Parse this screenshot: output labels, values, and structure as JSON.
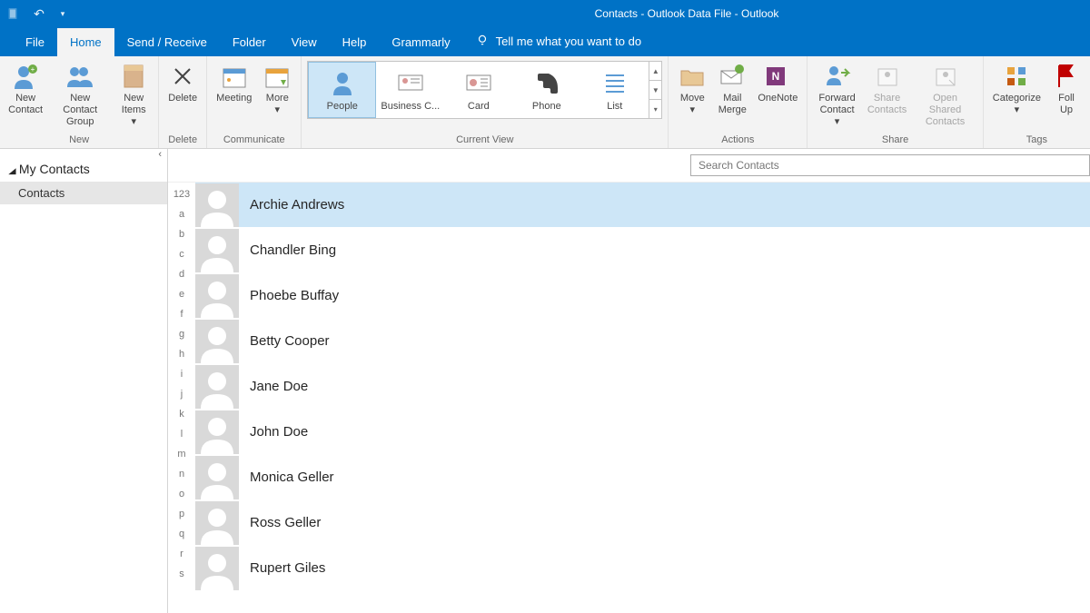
{
  "window": {
    "title": "Contacts - Outlook Data File  -  Outlook"
  },
  "tabs": {
    "file": "File",
    "home": "Home",
    "sendreceive": "Send / Receive",
    "folder": "Folder",
    "view": "View",
    "help": "Help",
    "grammarly": "Grammarly",
    "tellme": "Tell me what you want to do"
  },
  "ribbon": {
    "new": {
      "label": "New",
      "newcontact": "New\nContact",
      "newgroup": "New Contact\nGroup",
      "newitems": "New\nItems ▾"
    },
    "delete": {
      "label": "Delete",
      "delete": "Delete"
    },
    "communicate": {
      "label": "Communicate",
      "meeting": "Meeting",
      "more": "More\n▾"
    },
    "currentview": {
      "label": "Current View",
      "people": "People",
      "business": "Business C...",
      "card": "Card",
      "phone": "Phone",
      "list": "List"
    },
    "actions": {
      "label": "Actions",
      "move": "Move\n▾",
      "mailmerge": "Mail\nMerge",
      "onenote": "OneNote"
    },
    "share": {
      "label": "Share",
      "forward": "Forward\nContact ▾",
      "sharec": "Share\nContacts",
      "openshared": "Open Shared\nContacts"
    },
    "tags": {
      "label": "Tags",
      "categorize": "Categorize\n▾",
      "followup": "Foll\nUp"
    }
  },
  "nav": {
    "header": "My Contacts",
    "item": "Contacts"
  },
  "search": {
    "placeholder": "Search Contacts"
  },
  "alpha": [
    "123",
    "a",
    "b",
    "c",
    "d",
    "e",
    "f",
    "g",
    "h",
    "i",
    "j",
    "k",
    "l",
    "m",
    "n",
    "o",
    "p",
    "q",
    "r",
    "s"
  ],
  "contacts": [
    {
      "name": "Archie Andrews",
      "sel": true
    },
    {
      "name": "Chandler Bing"
    },
    {
      "name": "Phoebe Buffay"
    },
    {
      "name": "Betty Cooper"
    },
    {
      "name": "Jane Doe"
    },
    {
      "name": "John Doe"
    },
    {
      "name": "Monica Geller"
    },
    {
      "name": "Ross Geller"
    },
    {
      "name": "Rupert Giles"
    }
  ]
}
